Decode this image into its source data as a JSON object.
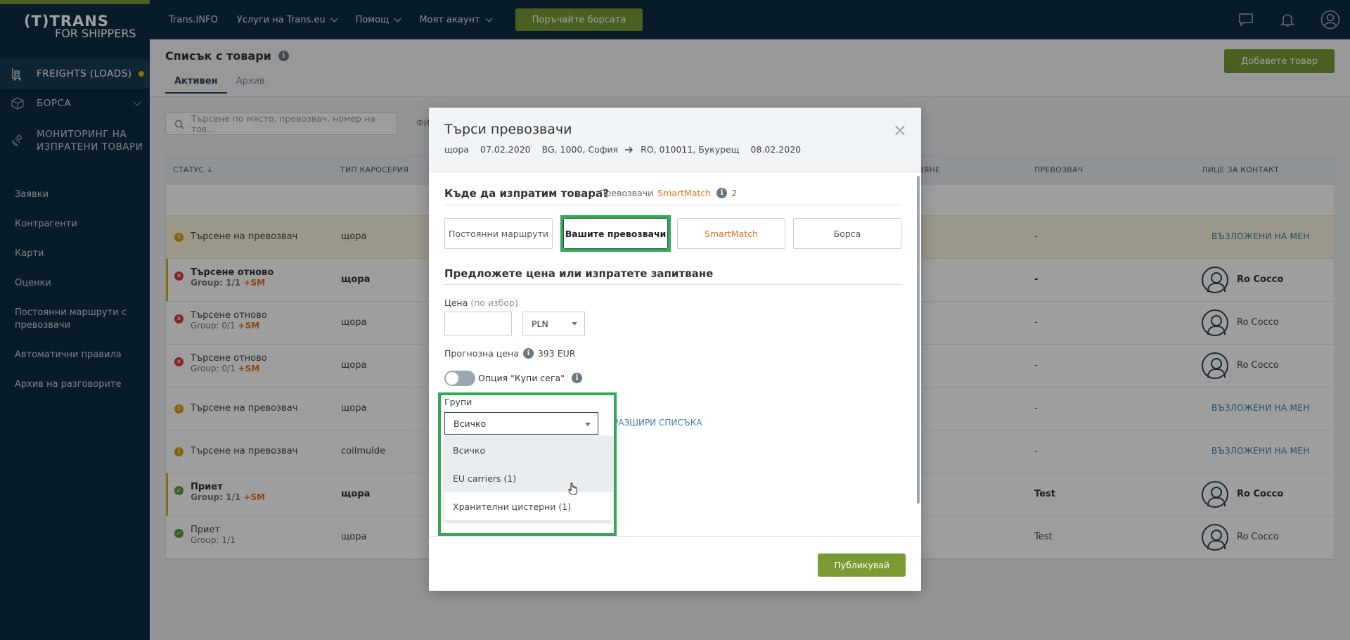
{
  "brand": {
    "line1": "(T)TRANS",
    "line2": "FOR SHIPPERS",
    "accent": "#7a9b34",
    "navy": "#0c2c42"
  },
  "sidebar": {
    "main": [
      {
        "label": "FREIGHTS (LOADS)",
        "icon": "loads-icon",
        "active": true,
        "dot": true
      },
      {
        "label": "БОРСА",
        "icon": "box-icon"
      },
      {
        "label": "МОНИТОРИНГ НА ИЗПРАТЕНИ ТОВАРИ",
        "icon": "satellite-icon"
      }
    ],
    "links": [
      "Заявки",
      "Контрагенти",
      "Карти",
      "Оценки",
      "Постоянни маршрути с превозвачи",
      "Автоматични правила",
      "Архив на разговорите"
    ]
  },
  "topbar": {
    "items": [
      "Trans.INFO",
      "Услуги на Trans.eu",
      "Помощ",
      "Моят акаунт"
    ],
    "cta": "Поръчайте борсата",
    "icons": [
      "chat-icon",
      "bell-icon",
      "user-icon"
    ]
  },
  "page": {
    "title": "Списък с товари",
    "tabs": [
      "Активен",
      "Архив"
    ],
    "add_button": "Добавете товар",
    "search_placeholder": "Търсене по място, превозвач, номер на тов...",
    "filter_fragment": "ФИ"
  },
  "table": {
    "headers": {
      "status": "СТАТУС",
      "body": "ТИП КАРОСЕРИЯ",
      "loading": "ВЯНЕ",
      "carrier": "ПРЕВОЗВАЧ",
      "contact": "ЛИЦЕ ЗА КОНТАКТ"
    },
    "rows": [
      {
        "status": "Търсене на превозвач",
        "group": "",
        "sm": "",
        "body": "щора",
        "carrier": "-",
        "contact": "ВЪЗЛОЖЕНИ НА МЕН",
        "type": "warn",
        "yellow": true,
        "marked": false,
        "bold": false,
        "avatar": false
      },
      {
        "status": "Търсене отново",
        "group": "Group: 1/1",
        "sm": "+SM",
        "body": "щора",
        "carrier": "-",
        "contact": "Ro Cocco",
        "type": "err",
        "yellow": false,
        "marked": true,
        "bold": true,
        "avatar": true
      },
      {
        "status": "Търсене отново",
        "group": "Group: 0/1",
        "sm": "+SM",
        "body": "щора",
        "carrier": "-",
        "contact": "Ro Cocco",
        "type": "err",
        "yellow": false,
        "marked": false,
        "bold": false,
        "avatar": true
      },
      {
        "status": "Търсене отново",
        "group": "Group: 0/1",
        "sm": "+SM",
        "body": "щора",
        "carrier": "-",
        "contact": "Ro Cocco",
        "type": "err",
        "yellow": false,
        "marked": false,
        "bold": false,
        "avatar": true
      },
      {
        "status": "Търсене на превозвач",
        "group": "",
        "sm": "",
        "body": "щора",
        "carrier": "-",
        "contact": "ВЪЗЛОЖЕНИ НА МЕН",
        "type": "warn",
        "yellow": false,
        "marked": false,
        "bold": false,
        "avatar": false
      },
      {
        "status": "Търсене на превозвач",
        "group": "",
        "sm": "",
        "body": "coilmulde",
        "carrier": "-",
        "contact": "ВЪЗЛОЖЕНИ НА МЕН",
        "type": "warn",
        "yellow": false,
        "marked": false,
        "bold": false,
        "avatar": false
      },
      {
        "status": "Приет",
        "group": "Group: 1/1",
        "sm": "+SM",
        "body": "щора",
        "carrier": "Test",
        "contact": "Ro Cocco",
        "type": "ok",
        "yellow": false,
        "marked": true,
        "bold": true,
        "avatar": true
      },
      {
        "status": "Приет",
        "group": "Group: 1/1",
        "sm": "",
        "body": "щора",
        "carrier": "Test",
        "contact": "Ro Cocco",
        "type": "ok",
        "yellow": false,
        "marked": false,
        "bold": false,
        "avatar": true
      }
    ]
  },
  "modal": {
    "title": "Търси превозвачи",
    "sub": {
      "body": "щора",
      "date_from": "07.02.2020",
      "from": "BG, 1000, София",
      "to": "RO, 010011, Букурещ",
      "date_to": "08.02.2020"
    },
    "where_title": "Къде да изпратим товара?",
    "carriers_label": "Превозвачи",
    "smartmatch": "SmartMatch",
    "carriers_count": "2",
    "options": [
      "Постоянни маршрути",
      "Вашите превозвачи",
      "SmartMatch",
      "Борса"
    ],
    "price_title": "Предложете цена или изпратете запитване",
    "price_label": "Цена",
    "price_optional": "(по избор)",
    "currency": "PLN",
    "forecast_label": "Прогнозна цена",
    "forecast_value": "393 EUR",
    "buy_now": "Опция \"Купи сега\"",
    "groups_label": "Групи",
    "groups_selected": "Всичко",
    "expand": "РАЗШИРИ СПИСЪКА",
    "behind_fragment": "и",
    "dropdown": [
      "Всичко",
      "EU carriers (1)",
      "Хранителни цистерни (1)"
    ],
    "publish": "Публикувай"
  }
}
